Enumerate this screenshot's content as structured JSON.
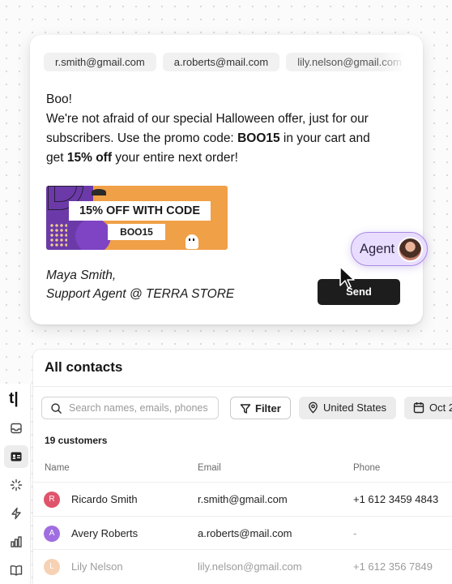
{
  "email": {
    "recipients": [
      "r.smith@gmail.com",
      "a.roberts@mail.com",
      "lily.nelson@gmail.com"
    ],
    "greeting": "Boo!",
    "line1": "We're not afraid of our special Halloween offer, just for our",
    "line2_pre": "subscribers. Use the promo code: ",
    "promo_code": "BOO15",
    "line2_post": " in your cart and",
    "line3_pre": "get ",
    "discount": "15% off",
    "line3_post": " your entire next order!",
    "banner_title": "15% OFF WITH CODE",
    "banner_code": "BOO15",
    "signature_name": "Maya Smith,",
    "signature_role": "Support Agent @ TERRA STORE",
    "send_label": "Send"
  },
  "agent": {
    "label": "Agent"
  },
  "app": {
    "logo": "t|",
    "nav": [
      "inbox",
      "contacts",
      "sparkle",
      "automation",
      "reports",
      "knowledge-base"
    ]
  },
  "contacts": {
    "title": "All contacts",
    "search_placeholder": "Search names, emails, phones",
    "filter_label": "Filter",
    "country_filter": "United States",
    "date_filter": "Oct 2",
    "count": "19 customers",
    "columns": [
      "Name",
      "Email",
      "Phone"
    ],
    "rows": [
      {
        "initial": "R",
        "name": "Ricardo Smith",
        "email": "r.smith@gmail.com",
        "phone": "+1 612 3459 4843",
        "color": "#e0546b"
      },
      {
        "initial": "A",
        "name": "Avery Roberts",
        "email": "a.roberts@mail.com",
        "phone": "-",
        "color": "#a06ee0"
      },
      {
        "initial": "L",
        "name": "Lily Nelson",
        "email": "lily.nelson@gmail.com",
        "phone": "+1 612 356 7849",
        "color": "#ef9a5a"
      }
    ]
  }
}
